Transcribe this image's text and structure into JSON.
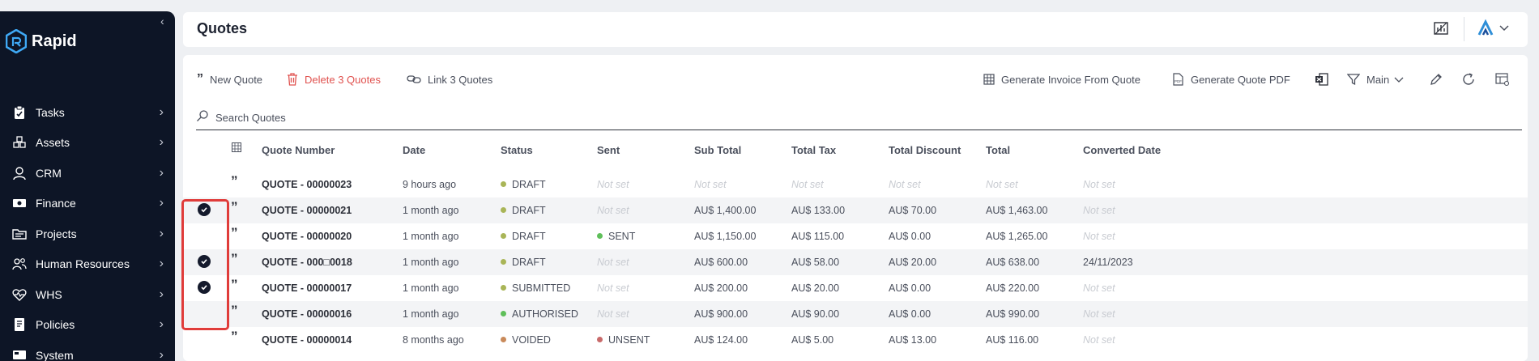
{
  "app": {
    "name": "Rapid"
  },
  "sidebar": {
    "items": [
      {
        "label": "Tasks",
        "icon": "clipboard-check-icon"
      },
      {
        "label": "Assets",
        "icon": "boxes-icon"
      },
      {
        "label": "CRM",
        "icon": "user-icon"
      },
      {
        "label": "Finance",
        "icon": "money-icon"
      },
      {
        "label": "Projects",
        "icon": "folder-icon"
      },
      {
        "label": "Human Resources",
        "icon": "people-icon"
      },
      {
        "label": "WHS",
        "icon": "heart-pulse-icon"
      },
      {
        "label": "Policies",
        "icon": "book-icon"
      },
      {
        "label": "System",
        "icon": "system-icon"
      }
    ]
  },
  "header": {
    "title": "Quotes"
  },
  "toolbar": {
    "new_quote": "New Quote",
    "delete": "Delete 3 Quotes",
    "link": "Link 3 Quotes",
    "generate_invoice": "Generate Invoice From Quote",
    "generate_pdf": "Generate Quote PDF",
    "view_label": "Main"
  },
  "search": {
    "placeholder": "Search Quotes"
  },
  "table": {
    "headers": [
      "Quote Number",
      "Date",
      "Status",
      "Sent",
      "Sub Total",
      "Total Tax",
      "Total Discount",
      "Total",
      "Converted Date"
    ],
    "not_set": "Not set",
    "rows": [
      {
        "checked": false,
        "number": "QUOTE - 00000023",
        "date": "9 hours ago",
        "status": "DRAFT",
        "status_color": "#a9b557",
        "sent": "",
        "sent_color": "",
        "sub_total": "",
        "tax": "",
        "discount": "",
        "total": "",
        "converted": ""
      },
      {
        "checked": true,
        "number": "QUOTE - 00000021",
        "date": "1 month ago",
        "status": "DRAFT",
        "status_color": "#a9b557",
        "sent": "",
        "sent_color": "",
        "sub_total": "AU$ 1,400.00",
        "tax": "AU$ 133.00",
        "discount": "AU$ 70.00",
        "total": "AU$ 1,463.00",
        "converted": ""
      },
      {
        "checked": false,
        "number": "QUOTE - 00000020",
        "date": "1 month ago",
        "status": "DRAFT",
        "status_color": "#a9b557",
        "sent": "SENT",
        "sent_color": "#5fbf5a",
        "sub_total": "AU$ 1,150.00",
        "tax": "AU$ 115.00",
        "discount": "AU$ 0.00",
        "total": "AU$ 1,265.00",
        "converted": ""
      },
      {
        "checked": true,
        "number": "QUOTE - 000□0018",
        "date": "1 month ago",
        "status": "DRAFT",
        "status_color": "#a9b557",
        "sent": "",
        "sent_color": "",
        "sub_total": "AU$ 600.00",
        "tax": "AU$ 58.00",
        "discount": "AU$ 20.00",
        "total": "AU$ 638.00",
        "converted": "24/11/2023"
      },
      {
        "checked": true,
        "number": "QUOTE - 00000017",
        "date": "1 month ago",
        "status": "SUBMITTED",
        "status_color": "#a9b557",
        "sent": "",
        "sent_color": "",
        "sub_total": "AU$ 200.00",
        "tax": "AU$ 20.00",
        "discount": "AU$ 0.00",
        "total": "AU$ 220.00",
        "converted": ""
      },
      {
        "checked": false,
        "number": "QUOTE - 00000016",
        "date": "1 month ago",
        "status": "AUTHORISED",
        "status_color": "#5fbf5a",
        "sent": "",
        "sent_color": "",
        "sub_total": "AU$ 900.00",
        "tax": "AU$ 90.00",
        "discount": "AU$ 0.00",
        "total": "AU$ 990.00",
        "converted": ""
      },
      {
        "checked": false,
        "number": "QUOTE - 00000014",
        "date": "8 months ago",
        "status": "VOIDED",
        "status_color": "#c98a5a",
        "sent": "UNSENT",
        "sent_color": "#c86a6a",
        "sub_total": "AU$ 124.00",
        "tax": "AU$ 5.00",
        "discount": "AU$ 13.00",
        "total": "AU$ 116.00",
        "converted": ""
      }
    ]
  }
}
